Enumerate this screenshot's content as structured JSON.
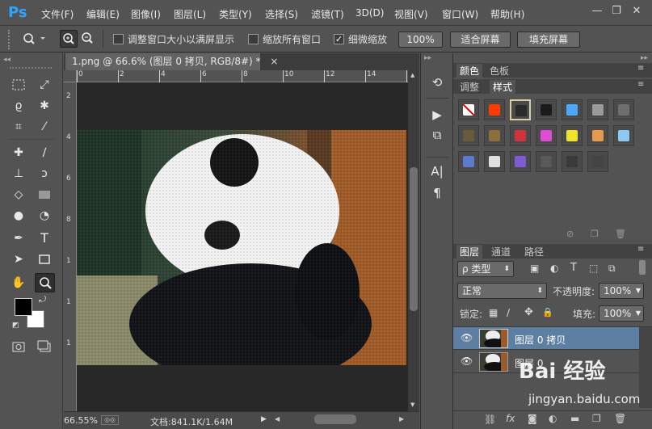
{
  "app": {
    "logo": "Ps"
  },
  "menu": [
    "文件(F)",
    "编辑(E)",
    "图像(I)",
    "图层(L)",
    "类型(Y)",
    "选择(S)",
    "滤镜(T)",
    "3D(D)",
    "视图(V)",
    "窗口(W)",
    "帮助(H)"
  ],
  "window_controls": {
    "minimize": "—",
    "restore": "❐",
    "close": "✕"
  },
  "options": {
    "resize_windows": "调整窗口大小以满屏显示",
    "zoom_all_windows": "缩放所有窗口",
    "scrubby_zoom": "细微缩放",
    "scrubby_checked": true,
    "zoom_100": "100%",
    "fit_screen": "适合屏幕",
    "fill_screen": "填充屏幕"
  },
  "document": {
    "tab_title": "1.png @ 66.6% (图层 0 拷贝, RGB/8#) *",
    "close": "×"
  },
  "rulers": {
    "top": [
      "0",
      "2",
      "4",
      "6",
      "8",
      "10",
      "12",
      "14",
      "16",
      "18"
    ],
    "left": [
      "2",
      "4",
      "6",
      "8",
      "1",
      "1",
      "1"
    ]
  },
  "status": {
    "zoom": "66.55%",
    "doc_info": "文档:841.1K/1.64M"
  },
  "color_panel": {
    "tabs": [
      "颜色",
      "色板"
    ],
    "tabs2": [
      "调整",
      "样式"
    ]
  },
  "styles_swatches": [
    {
      "name": "none",
      "color": "#ffffff"
    },
    {
      "name": "style-2",
      "color": "#ff3a00"
    },
    {
      "name": "style-3",
      "color": "#2a2a2a"
    },
    {
      "name": "style-4",
      "color": "#1b1b1b"
    },
    {
      "name": "style-5",
      "color": "#4aa8ff"
    },
    {
      "name": "style-6",
      "color": "#9b9b9b"
    },
    {
      "name": "style-7",
      "color": "#6f6f6f"
    },
    {
      "name": "style-8",
      "color": "#6b5a3a"
    },
    {
      "name": "style-9",
      "color": "#8a6e3b"
    },
    {
      "name": "style-10",
      "color": "#d0343a"
    },
    {
      "name": "style-11",
      "color": "#e04ad6"
    },
    {
      "name": "style-12",
      "color": "#f2e12a"
    },
    {
      "name": "style-13",
      "color": "#e79a4b"
    },
    {
      "name": "style-14",
      "color": "#8cc8f0"
    },
    {
      "name": "style-15",
      "color": "#5a7bd0"
    },
    {
      "name": "style-16",
      "color": "#e0e0e0"
    },
    {
      "name": "style-17",
      "color": "#7d5bd6"
    },
    {
      "name": "style-18",
      "color": "#5a5a5a"
    },
    {
      "name": "style-19",
      "color": "#3a3a3a"
    },
    {
      "name": "style-20",
      "color": "#444444"
    }
  ],
  "layers_panel": {
    "tabs": [
      "图层",
      "通道",
      "路径"
    ],
    "filter_label": "ρ 类型",
    "blend_mode": "正常",
    "opacity_label": "不透明度:",
    "opacity_value": "100%",
    "lock_label": "锁定:",
    "fill_label": "填充:",
    "fill_value": "100%",
    "layers": [
      {
        "name": "图层 0 拷贝",
        "selected": true
      },
      {
        "name": "图层 0",
        "selected": false
      }
    ]
  },
  "watermark": {
    "text": "Bai 经验",
    "url": "jingyan.baidu.com"
  },
  "colors": {
    "accent": "#2fa4ff",
    "selected_layer": "#5d7fa1"
  }
}
